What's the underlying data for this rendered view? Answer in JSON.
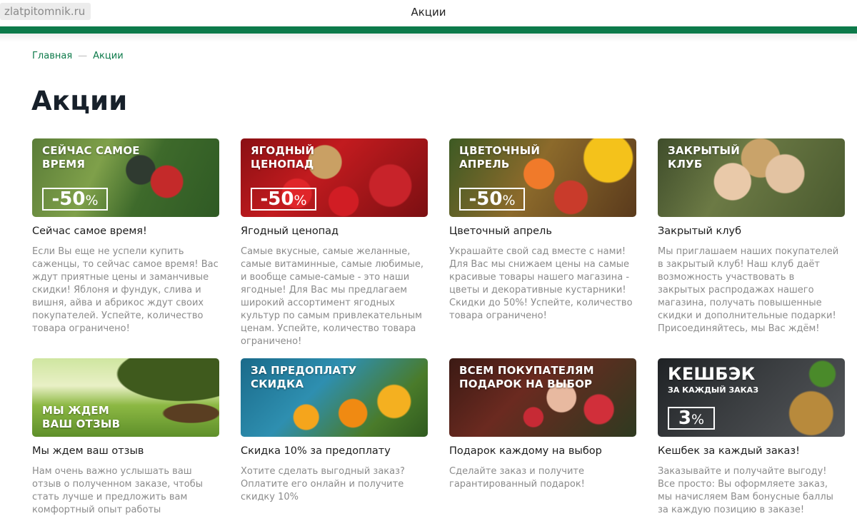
{
  "browser": {
    "url": "zlatpitomnik.ru",
    "tab_title": "Акции"
  },
  "breadcrumb": {
    "home": "Главная",
    "separator": "—",
    "current": "Акции"
  },
  "page_title": "Акции",
  "colors": {
    "brand_green": "#0d7a4a",
    "muted_text": "#8b8b8b"
  },
  "cards": [
    {
      "banner_text": "Сейчас самое время",
      "badge": "-50",
      "badge_unit": "%",
      "title": "Сейчас самое время!",
      "desc": "Если Вы еще не успели купить саженцы, то сейчас самое время! Вас ждут приятные цены и заманчивые скидки! Яблоня и фундук, слива и вишня, айва и абрикос ждут своих покупателей. Успейте, количество товара ограничено!"
    },
    {
      "banner_text": "Ягодный ценопад",
      "badge": "-50",
      "badge_unit": "%",
      "title": "Ягодный ценопад",
      "desc": "Самые вкусные, самые желанные, самые витаминные, самые любимые, и вообще самые-самые - это наши ягодные! Для Вас мы предлагаем широкий ассортимент ягодных культур по самым привлекательным ценам. Успейте, количество товара ограничено!"
    },
    {
      "banner_text": "Цветочный апрель",
      "badge": "-50",
      "badge_unit": "%",
      "title": "Цветочный апрель",
      "desc": "Украшайте свой сад вместе с нами! Для Вас мы снижаем цены на самые красивые товары нашего магазина - цветы и декоративные кустарники! Скидки до 50%! Успейте, количество товара ограничено!"
    },
    {
      "banner_text": "Закрытый клуб",
      "title": "Закрытый клуб",
      "desc": "Мы приглашаем наших покупателей в закрытый клуб! Наш клуб даёт возможность участвовать в закрытых распродажах нашего магазина, получать повышенные скидки и дополнительные подарки! Присоединяйтесь, мы Вас ждём!"
    },
    {
      "banner_text": "Мы ждем ваш отзыв",
      "title": "Мы ждем ваш отзыв",
      "desc": "Нам очень важно услышать ваш отзыв о полученном заказе, чтобы стать лучше и предложить вам комфортный опыт работы"
    },
    {
      "banner_text": "За предоплату скидка",
      "title": "Скидка 10% за предоплату",
      "desc": "Хотите сделать выгодный заказ? Оплатите его онлайн и получите скидку 10%"
    },
    {
      "banner_text": "Всем покупателям подарок на выбор",
      "title": "Подарок каждому на выбор",
      "desc": "Сделайте заказ и получите гарантированный подарок!"
    },
    {
      "banner_text": "Кешбэк",
      "banner_sub": "за каждый заказ",
      "badge": "3",
      "badge_unit": "%",
      "title": "Кешбек за каждый заказ!",
      "desc": "Заказывайте и получайте выгоду! Все просто: Вы оформляете заказ, мы начисляем Вам бонусные баллы за каждую позицию в заказе!"
    }
  ]
}
